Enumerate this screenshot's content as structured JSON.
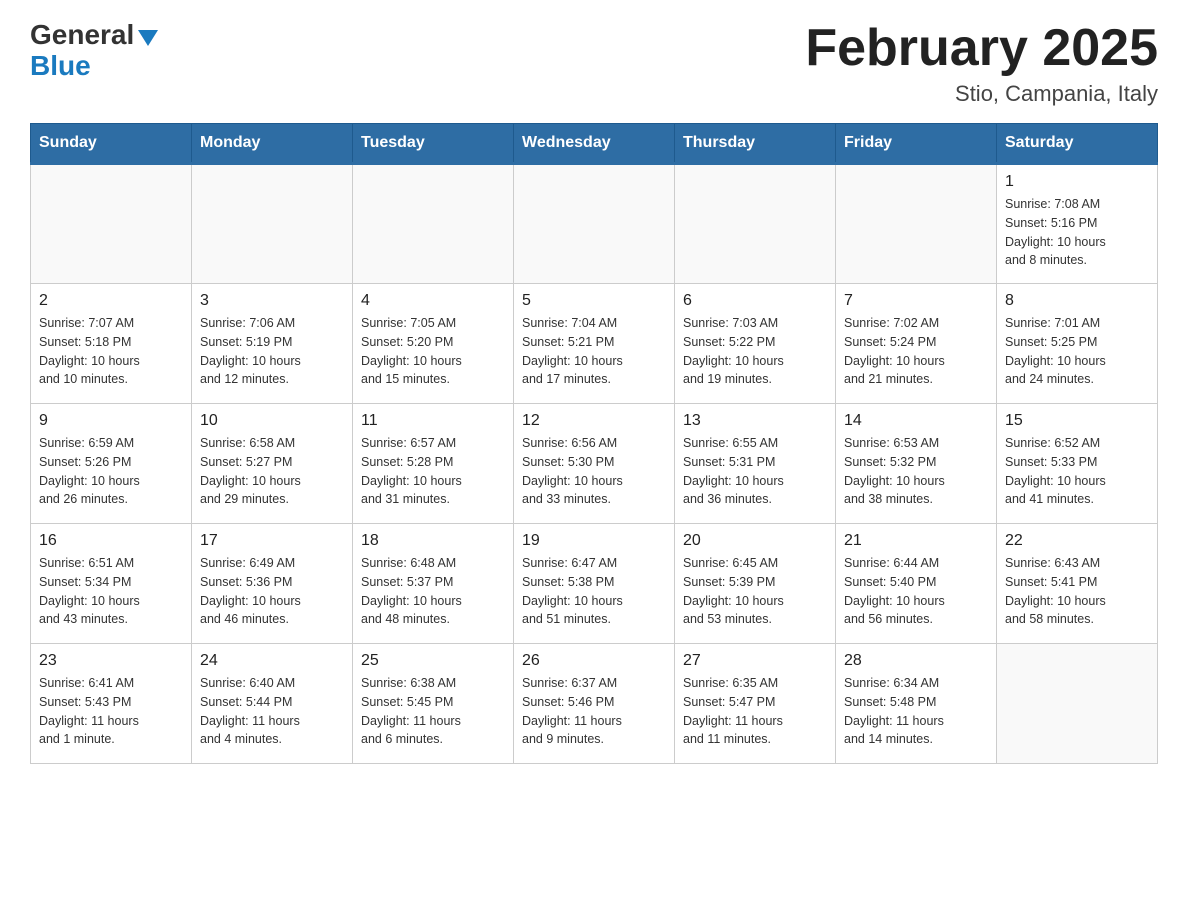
{
  "header": {
    "logo_general": "General",
    "logo_blue": "Blue",
    "month_title": "February 2025",
    "location": "Stio, Campania, Italy"
  },
  "weekdays": [
    "Sunday",
    "Monday",
    "Tuesday",
    "Wednesday",
    "Thursday",
    "Friday",
    "Saturday"
  ],
  "weeks": [
    [
      {
        "day": "",
        "info": ""
      },
      {
        "day": "",
        "info": ""
      },
      {
        "day": "",
        "info": ""
      },
      {
        "day": "",
        "info": ""
      },
      {
        "day": "",
        "info": ""
      },
      {
        "day": "",
        "info": ""
      },
      {
        "day": "1",
        "info": "Sunrise: 7:08 AM\nSunset: 5:16 PM\nDaylight: 10 hours\nand 8 minutes."
      }
    ],
    [
      {
        "day": "2",
        "info": "Sunrise: 7:07 AM\nSunset: 5:18 PM\nDaylight: 10 hours\nand 10 minutes."
      },
      {
        "day": "3",
        "info": "Sunrise: 7:06 AM\nSunset: 5:19 PM\nDaylight: 10 hours\nand 12 minutes."
      },
      {
        "day": "4",
        "info": "Sunrise: 7:05 AM\nSunset: 5:20 PM\nDaylight: 10 hours\nand 15 minutes."
      },
      {
        "day": "5",
        "info": "Sunrise: 7:04 AM\nSunset: 5:21 PM\nDaylight: 10 hours\nand 17 minutes."
      },
      {
        "day": "6",
        "info": "Sunrise: 7:03 AM\nSunset: 5:22 PM\nDaylight: 10 hours\nand 19 minutes."
      },
      {
        "day": "7",
        "info": "Sunrise: 7:02 AM\nSunset: 5:24 PM\nDaylight: 10 hours\nand 21 minutes."
      },
      {
        "day": "8",
        "info": "Sunrise: 7:01 AM\nSunset: 5:25 PM\nDaylight: 10 hours\nand 24 minutes."
      }
    ],
    [
      {
        "day": "9",
        "info": "Sunrise: 6:59 AM\nSunset: 5:26 PM\nDaylight: 10 hours\nand 26 minutes."
      },
      {
        "day": "10",
        "info": "Sunrise: 6:58 AM\nSunset: 5:27 PM\nDaylight: 10 hours\nand 29 minutes."
      },
      {
        "day": "11",
        "info": "Sunrise: 6:57 AM\nSunset: 5:28 PM\nDaylight: 10 hours\nand 31 minutes."
      },
      {
        "day": "12",
        "info": "Sunrise: 6:56 AM\nSunset: 5:30 PM\nDaylight: 10 hours\nand 33 minutes."
      },
      {
        "day": "13",
        "info": "Sunrise: 6:55 AM\nSunset: 5:31 PM\nDaylight: 10 hours\nand 36 minutes."
      },
      {
        "day": "14",
        "info": "Sunrise: 6:53 AM\nSunset: 5:32 PM\nDaylight: 10 hours\nand 38 minutes."
      },
      {
        "day": "15",
        "info": "Sunrise: 6:52 AM\nSunset: 5:33 PM\nDaylight: 10 hours\nand 41 minutes."
      }
    ],
    [
      {
        "day": "16",
        "info": "Sunrise: 6:51 AM\nSunset: 5:34 PM\nDaylight: 10 hours\nand 43 minutes."
      },
      {
        "day": "17",
        "info": "Sunrise: 6:49 AM\nSunset: 5:36 PM\nDaylight: 10 hours\nand 46 minutes."
      },
      {
        "day": "18",
        "info": "Sunrise: 6:48 AM\nSunset: 5:37 PM\nDaylight: 10 hours\nand 48 minutes."
      },
      {
        "day": "19",
        "info": "Sunrise: 6:47 AM\nSunset: 5:38 PM\nDaylight: 10 hours\nand 51 minutes."
      },
      {
        "day": "20",
        "info": "Sunrise: 6:45 AM\nSunset: 5:39 PM\nDaylight: 10 hours\nand 53 minutes."
      },
      {
        "day": "21",
        "info": "Sunrise: 6:44 AM\nSunset: 5:40 PM\nDaylight: 10 hours\nand 56 minutes."
      },
      {
        "day": "22",
        "info": "Sunrise: 6:43 AM\nSunset: 5:41 PM\nDaylight: 10 hours\nand 58 minutes."
      }
    ],
    [
      {
        "day": "23",
        "info": "Sunrise: 6:41 AM\nSunset: 5:43 PM\nDaylight: 11 hours\nand 1 minute."
      },
      {
        "day": "24",
        "info": "Sunrise: 6:40 AM\nSunset: 5:44 PM\nDaylight: 11 hours\nand 4 minutes."
      },
      {
        "day": "25",
        "info": "Sunrise: 6:38 AM\nSunset: 5:45 PM\nDaylight: 11 hours\nand 6 minutes."
      },
      {
        "day": "26",
        "info": "Sunrise: 6:37 AM\nSunset: 5:46 PM\nDaylight: 11 hours\nand 9 minutes."
      },
      {
        "day": "27",
        "info": "Sunrise: 6:35 AM\nSunset: 5:47 PM\nDaylight: 11 hours\nand 11 minutes."
      },
      {
        "day": "28",
        "info": "Sunrise: 6:34 AM\nSunset: 5:48 PM\nDaylight: 11 hours\nand 14 minutes."
      },
      {
        "day": "",
        "info": ""
      }
    ]
  ]
}
